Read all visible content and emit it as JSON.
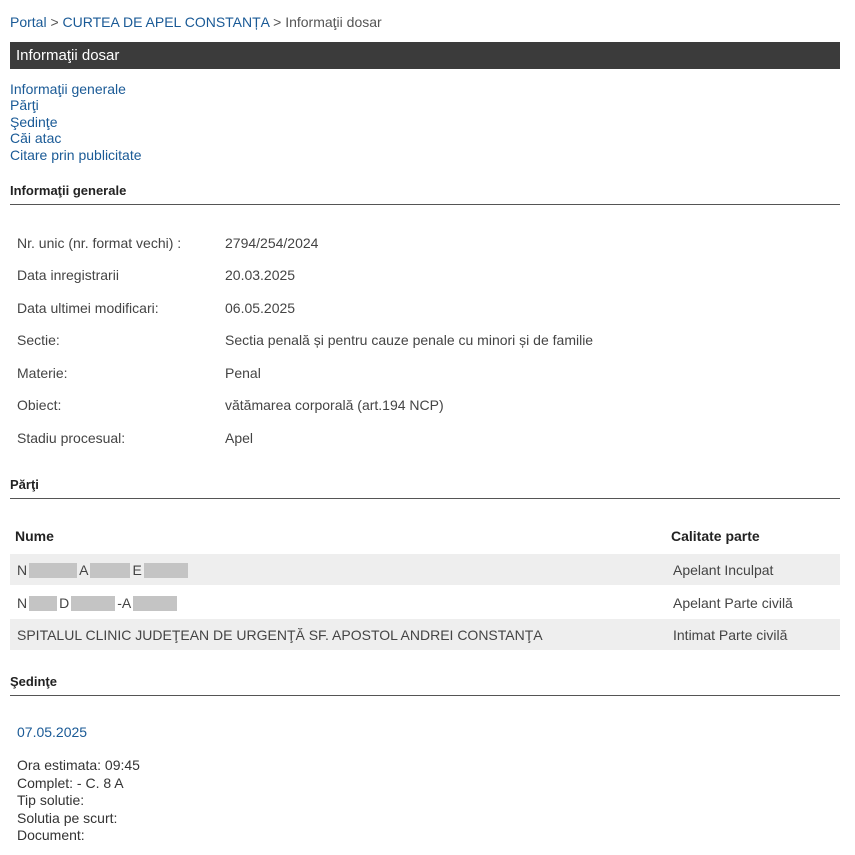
{
  "breadcrumb": {
    "portal": "Portal",
    "separator": ">",
    "court": "CURTEA DE APEL CONSTANȚA",
    "current": "Informaţii dosar"
  },
  "title": "Informaţii dosar",
  "nav": {
    "items": [
      "Informaţii generale",
      "Părţi",
      "Şedinţe",
      "Căi atac",
      "Citare prin publicitate"
    ]
  },
  "general": {
    "heading": "Informaţii generale",
    "rows": [
      {
        "label": "Nr. unic (nr. format vechi) :",
        "value": "2794/254/2024"
      },
      {
        "label": "Data inregistrarii",
        "value": "20.03.2025"
      },
      {
        "label": "Data ultimei modificari:",
        "value": "06.05.2025"
      },
      {
        "label": "Sectie:",
        "value": "Sectia penală și pentru cauze penale cu minori și de familie"
      },
      {
        "label": "Materie:",
        "value": "Penal"
      },
      {
        "label": "Obiect:",
        "value": "vătămarea corporală (art.194 NCP)"
      },
      {
        "label": "Stadiu procesual:",
        "value": "Apel"
      }
    ]
  },
  "parties": {
    "heading": "Părţi",
    "columns": {
      "name": "Nume",
      "role": "Calitate parte"
    },
    "rows": [
      {
        "name_parts": [
          "N",
          "A",
          "E"
        ],
        "role": "Apelant Inculpat"
      },
      {
        "name_parts": [
          "N",
          "D",
          "-A"
        ],
        "role": "Apelant Parte civilă"
      },
      {
        "name": "SPITALUL CLINIC JUDEŢEAN DE URGENŢĂ SF. APOSTOL ANDREI CONSTANŢA",
        "role": "Intimat Parte civilă"
      }
    ]
  },
  "hearings": {
    "heading": "Şedinţe",
    "date": "07.05.2025",
    "details": [
      "Ora estimata: 09:45",
      "Complet: - C. 8 A",
      "Tip solutie:",
      "Solutia pe scurt:",
      "Document:"
    ]
  }
}
